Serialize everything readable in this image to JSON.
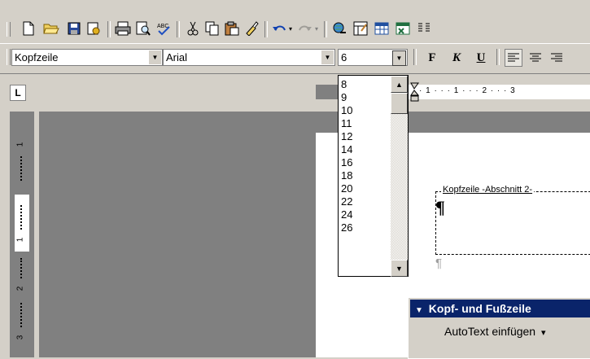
{
  "standard_toolbar": {
    "icons": [
      "new-document-icon",
      "open-folder-icon",
      "save-icon",
      "permission-icon",
      "print-icon",
      "print-preview-icon",
      "spelling-icon",
      "cut-icon",
      "copy-icon",
      "paste-icon",
      "format-painter-icon",
      "undo-icon",
      "redo-icon",
      "hyperlink-icon",
      "tables-borders-icon",
      "insert-table-icon",
      "insert-excel-icon",
      "columns-icon"
    ]
  },
  "formatting_toolbar": {
    "style_value": "Kopfzeile",
    "font_value": "Arial",
    "size_value": "6",
    "bold_label": "F",
    "italic_label": "K",
    "underline_label": "U"
  },
  "font_size_dropdown": {
    "options": [
      "8",
      "9",
      "10",
      "11",
      "12",
      "14",
      "16",
      "18",
      "20",
      "22",
      "24",
      "26"
    ]
  },
  "ruler": {
    "tab_selector": "L",
    "marks": "· 1 · · · 1 · · · 2 · · · 3"
  },
  "vertical_ruler": {
    "marks": [
      "1",
      "1",
      "2",
      "3"
    ]
  },
  "document": {
    "header_label": "Kopfzeile -Abschnitt 2-",
    "pilcrow": "¶",
    "pilcrow_below": "¶"
  },
  "header_footer_toolbar": {
    "title": "Kopf- und Fußzeile",
    "title_arrow": "▼",
    "autotext_button": "AutoText einfügen",
    "autotext_arrow": "▾"
  },
  "colors": {
    "face": "#d4d0c8",
    "workspace_gray": "#808080",
    "title_blue": "#0a246a"
  }
}
